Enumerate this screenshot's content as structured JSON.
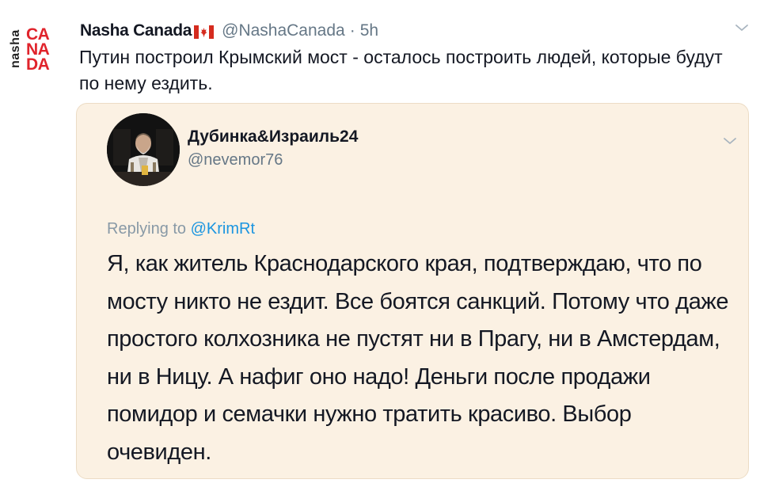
{
  "tweet": {
    "logo": {
      "top_word": "nasha",
      "lines": [
        "CA",
        "NA",
        "DA"
      ],
      "brand_color": "#e0232b"
    },
    "author_name": "Nasha Canada",
    "flag_icon": "canada-flag-icon",
    "author_handle": "@NashaCanada",
    "separator": "·",
    "timestamp": "5h",
    "menu_icon": "chevron-down-icon",
    "text": "Путин построил Крымский мост - осталось построить людей, которые будут по нему ездить."
  },
  "quoted_tweet": {
    "avatar_icon": "user-avatar",
    "author_name": "Дубинка&Израиль24",
    "author_handle": "@nevemor76",
    "menu_icon": "chevron-down-icon",
    "replying_prefix": "Replying to",
    "replying_to": "@KrimRt",
    "text": "Я, как житель Краснодарского края, подтверждаю, что по мосту никто не ездит. Все боятся санкций. Потому что даже простого колхозника не пустят ни в Прагу, ни в Амстердам, ни в Ницу. А нафиг оно надо! Деньги после продажи помидор и семачки нужно тратить красиво. Выбор очевиден.",
    "background_color": "#fbf1e3"
  },
  "colors": {
    "text_primary": "#141823",
    "text_secondary": "#657786",
    "link": "#1b95e0"
  }
}
